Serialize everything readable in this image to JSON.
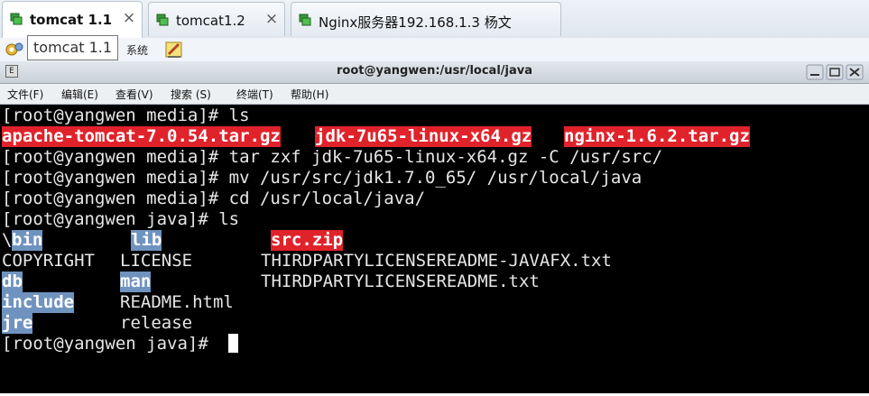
{
  "tabs": [
    {
      "label": "tomcat 1.1",
      "active": true
    },
    {
      "label": "tomcat1.2",
      "active": false
    },
    {
      "label": "Nginx服务器192.168.1.3 杨文",
      "active": false
    }
  ],
  "tab_close_glyph": "×",
  "toolbar": {
    "tooltip": "tomcat 1.1",
    "system_label": "系统"
  },
  "window": {
    "title": "root@yangwen:/usr/local/java",
    "icon_glyph": "E"
  },
  "menu": {
    "items": [
      "文件(F)",
      "编辑(E)",
      "查看(V)",
      "搜索 (S)",
      "终端(T)",
      "帮助(H)"
    ]
  },
  "terminal": {
    "lines": [
      {
        "prompt": "[root@yangwen media]# ",
        "command": "ls"
      },
      {
        "files": [
          "apache-tomcat-7.0.54.tar.gz",
          "jdk-7u65-linux-x64.gz",
          "nginx-1.6.2.tar.gz"
        ]
      },
      {
        "prompt": "[root@yangwen media]# ",
        "command": "tar zxf jdk-7u65-linux-x64.gz -C /usr/src/"
      },
      {
        "prompt": "[root@yangwen media]# ",
        "command": "mv /usr/src/jdk1.7.0_65/ /usr/local/java"
      },
      {
        "prompt": "[root@yangwen media]# ",
        "command": "cd /usr/local/java/"
      },
      {
        "prompt": "[root@yangwen java]# ",
        "command": "ls"
      },
      {
        "lead": "\\",
        "cols": [
          "bin",
          "lib",
          "src.zip"
        ]
      },
      {
        "cols": [
          "COPYRIGHT",
          "LICENSE",
          "THIRDPARTYLICENSEREADME-JAVAFX.txt"
        ]
      },
      {
        "cols": [
          "db",
          "man",
          "THIRDPARTYLICENSEREADME.txt"
        ]
      },
      {
        "cols": [
          "include",
          "README.html"
        ]
      },
      {
        "cols": [
          "jre",
          "release"
        ]
      },
      {
        "prompt": "[root@yangwen java]# ",
        "command": ""
      }
    ]
  },
  "colors": {
    "archive_highlight": "#e0222a",
    "directory_highlight": "#6f93bf",
    "terminal_bg": "#000000",
    "terminal_fg": "#e6e6e6"
  }
}
